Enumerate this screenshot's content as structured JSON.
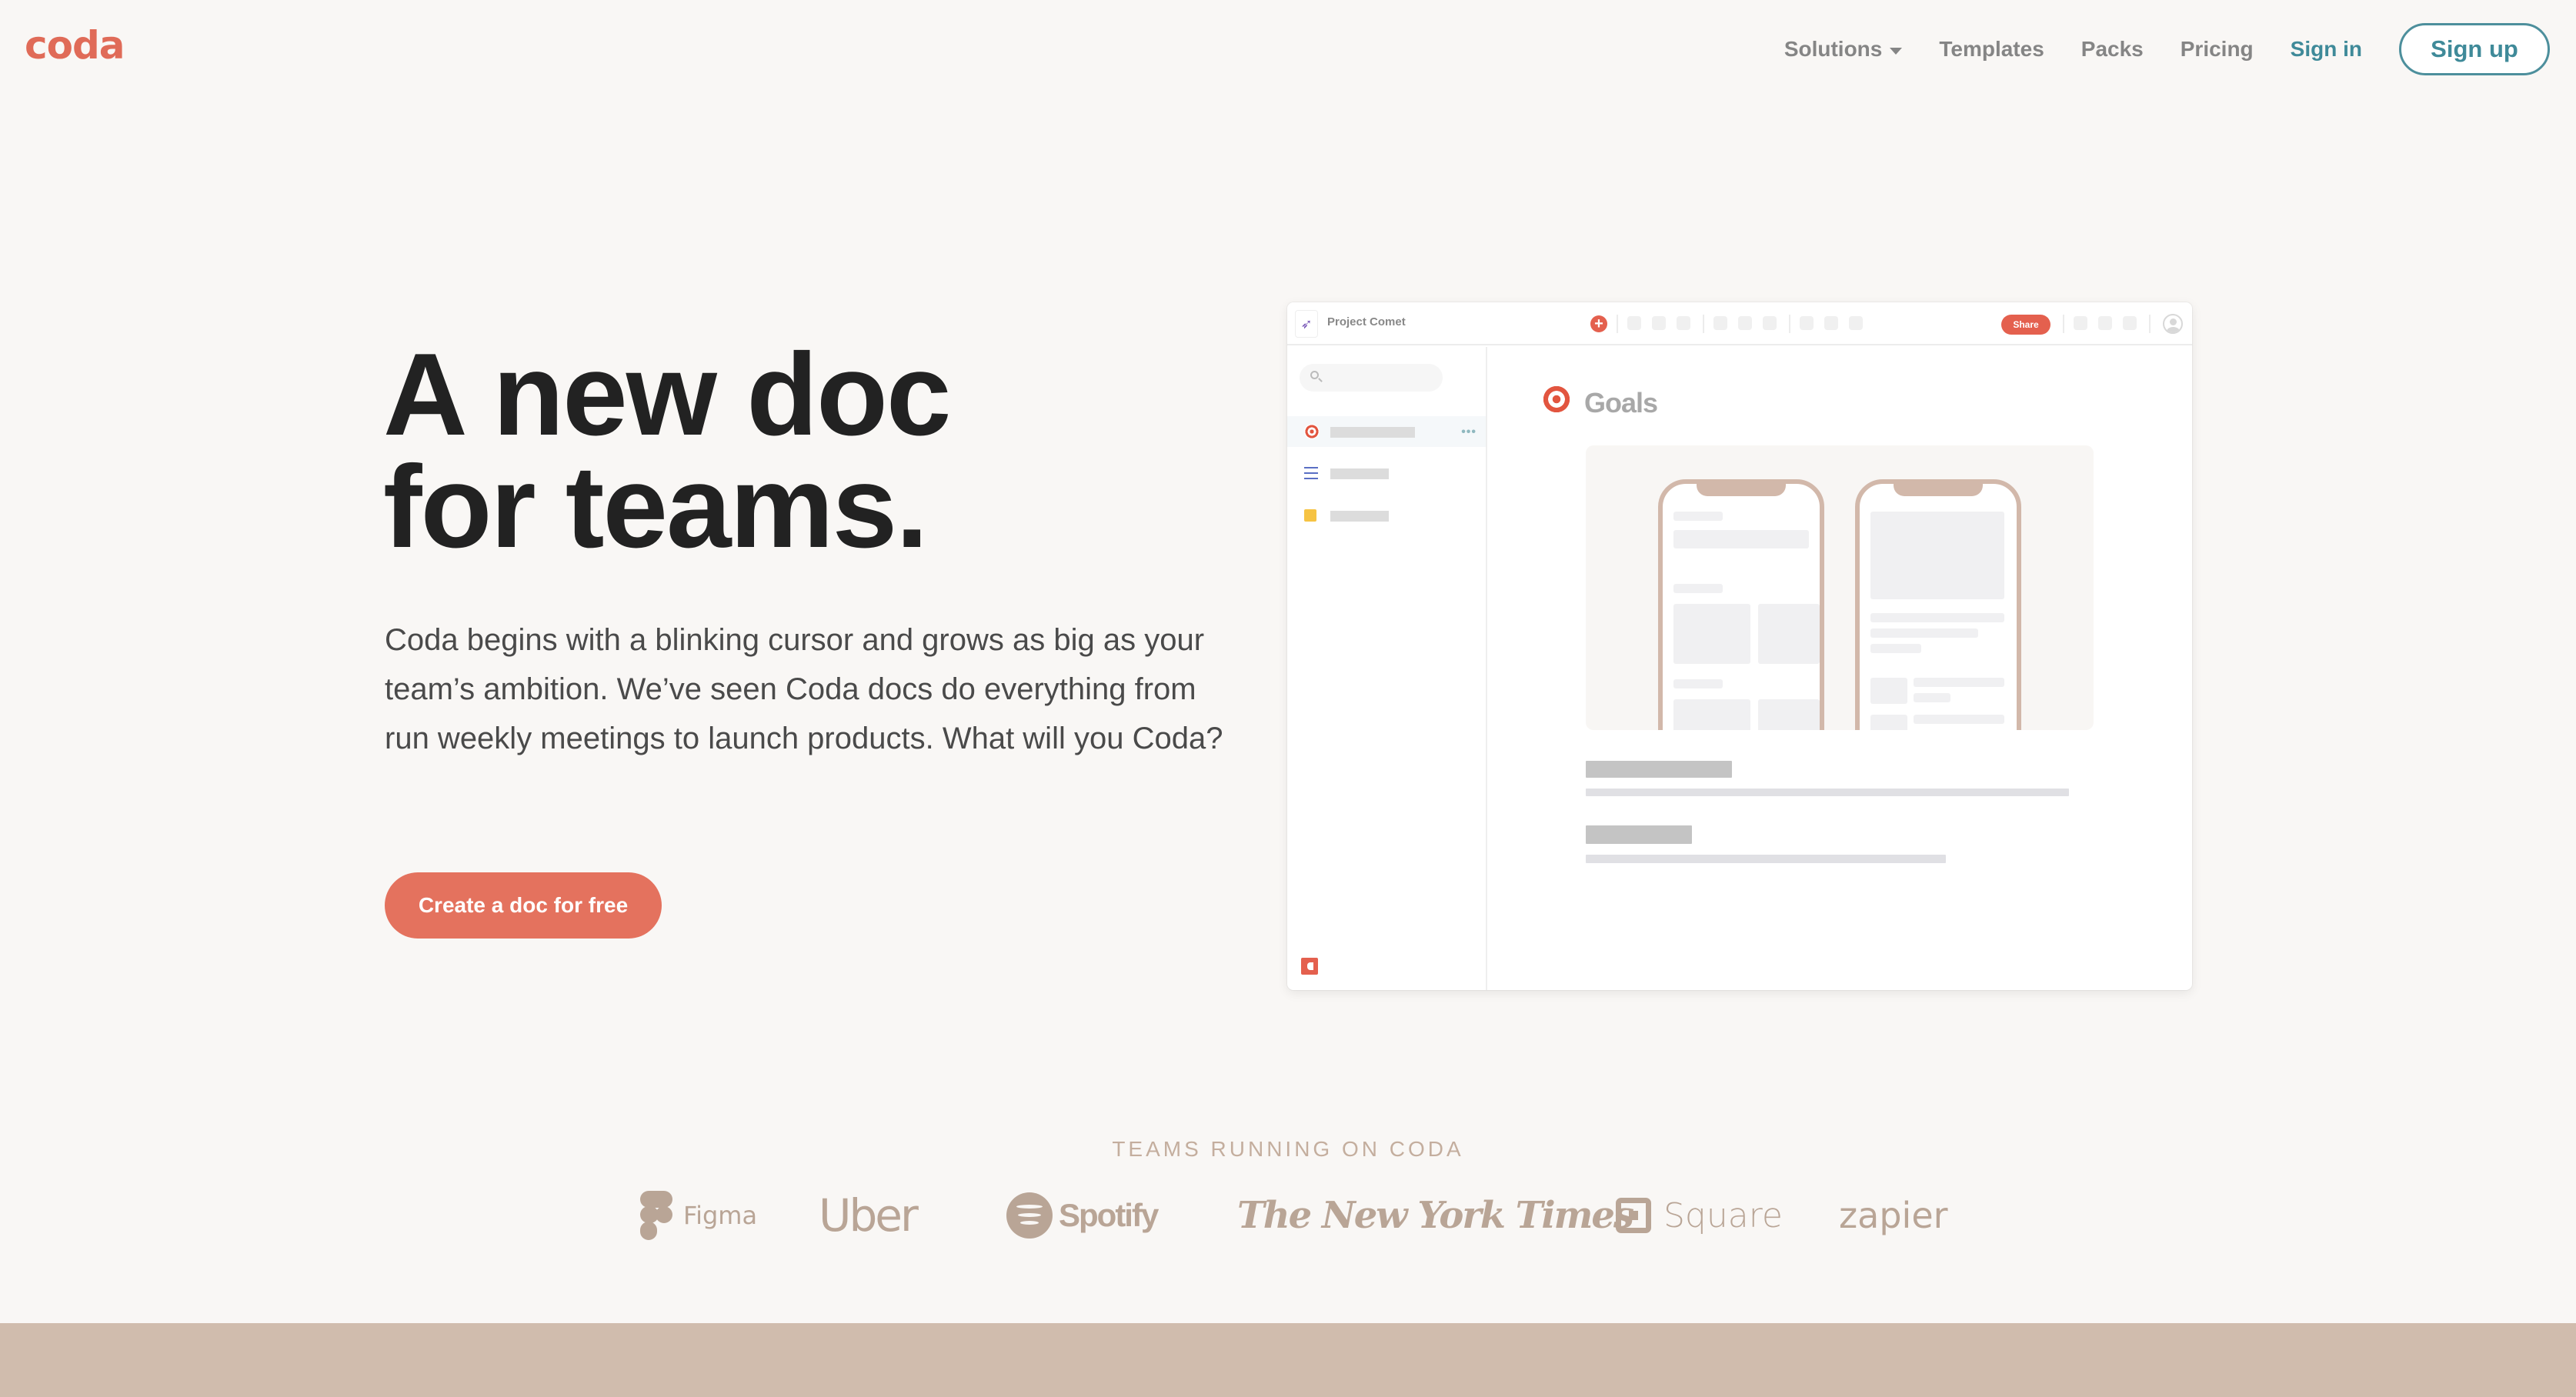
{
  "brand": {
    "logo_text": "coda",
    "accent_color": "#e06b58",
    "cta_color": "#e4725e",
    "link_color": "#3f8a99"
  },
  "nav": {
    "solutions": "Solutions",
    "templates": "Templates",
    "packs": "Packs",
    "pricing": "Pricing",
    "sign_in": "Sign in",
    "sign_up": "Sign up"
  },
  "hero": {
    "headline_line1": "A new doc",
    "headline_line2": "for teams.",
    "lede": "Coda begins with a blinking cursor and grows as big as your team’s ambition. We’ve seen Coda docs do everything from run weekly meetings to launch products. What will you Coda?",
    "cta": "Create a doc for free"
  },
  "mock_app": {
    "doc_title": "Project Comet",
    "share_label": "Share",
    "page_title": "Goals",
    "sidebar_items": [
      {
        "icon": "target-icon",
        "active": true
      },
      {
        "icon": "checklist-icon",
        "active": false
      },
      {
        "icon": "note-icon",
        "active": false
      }
    ],
    "more_glyph": "•••",
    "plus_glyph": "+"
  },
  "logos": {
    "label": "TEAMS RUNNING ON CODA",
    "brands": [
      "Figma",
      "Uber",
      "Spotify",
      "The New York Times",
      "Square",
      "zapier"
    ]
  }
}
